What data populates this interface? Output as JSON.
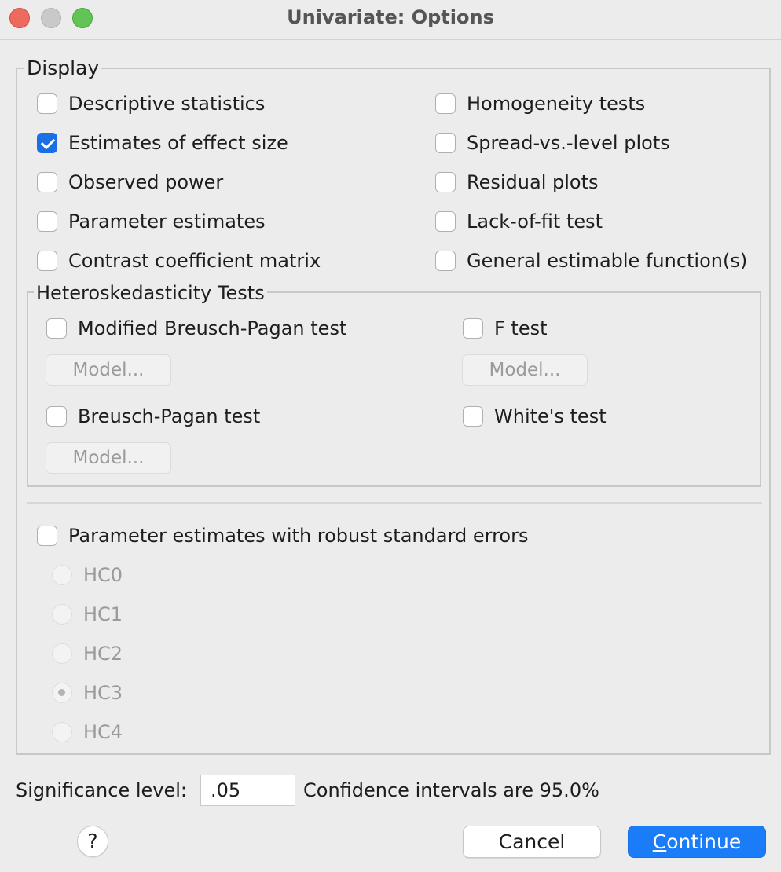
{
  "window": {
    "title": "Univariate: Options"
  },
  "display": {
    "legend": "Display",
    "left_options": [
      {
        "label": "Descriptive statistics",
        "checked": false
      },
      {
        "label": "Estimates of effect size",
        "checked": true
      },
      {
        "label": "Observed power",
        "checked": false
      },
      {
        "label": "Parameter estimates",
        "checked": false
      },
      {
        "label": "Contrast coefficient matrix",
        "checked": false
      }
    ],
    "right_options": [
      {
        "label": "Homogeneity tests",
        "checked": false
      },
      {
        "label": "Spread-vs.-level plots",
        "checked": false
      },
      {
        "label": "Residual plots",
        "checked": false
      },
      {
        "label": "Lack-of-fit test",
        "checked": false
      },
      {
        "label": "General estimable function(s)",
        "checked": false
      }
    ]
  },
  "hetero": {
    "legend": "Heteroskedasticity Tests",
    "modified_bp": "Modified Breusch-Pagan test",
    "f_test": "F test",
    "bp": "Breusch-Pagan test",
    "white": "White's test",
    "model_button": "Model..."
  },
  "robust": {
    "label": "Parameter estimates with robust standard errors",
    "options": [
      "HC0",
      "HC1",
      "HC2",
      "HC3",
      "HC4"
    ],
    "selected": "HC3"
  },
  "footer": {
    "sig_label": "Significance level:",
    "sig_value": ".05",
    "ci_text": "Confidence intervals are 95.0%",
    "help": "?",
    "cancel": "Cancel",
    "continue_first": "C",
    "continue_rest": "ontinue"
  }
}
